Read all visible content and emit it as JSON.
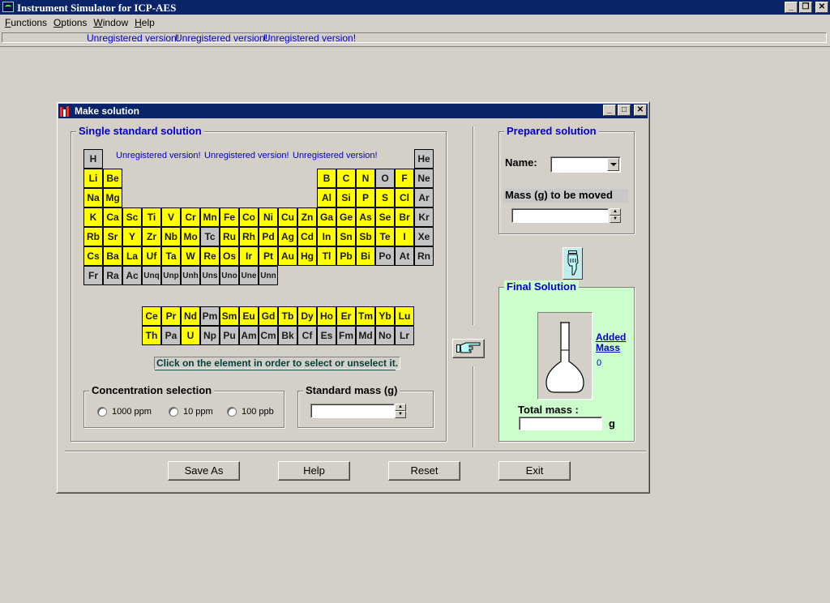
{
  "window": {
    "title": "Instrument Simulator for ICP-AES",
    "minimize": "_",
    "restore": "❐",
    "close": "✕"
  },
  "menu": {
    "items": [
      "Functions",
      "Options",
      "Window",
      "Help"
    ],
    "underlined": [
      "F",
      "O",
      "W",
      "H"
    ]
  },
  "status": {
    "unregistered": [
      "Unregistered version!",
      "Unregistered version!",
      "Unregistered version!"
    ]
  },
  "dialog": {
    "title": "Make solution",
    "single_standard": {
      "title": "Single standard solution",
      "unregistered": [
        "Unregistered version!",
        "Unregistered version!",
        "Unregistered version!"
      ],
      "elements": [
        {
          "s": "H",
          "c": "g"
        },
        {
          "s": "He",
          "c": "g"
        },
        {
          "s": "Li",
          "c": "y"
        },
        {
          "s": "Be",
          "c": "y"
        },
        {
          "s": "B",
          "c": "y"
        },
        {
          "s": "C",
          "c": "y"
        },
        {
          "s": "N",
          "c": "y"
        },
        {
          "s": "O",
          "c": "g"
        },
        {
          "s": "F",
          "c": "y"
        },
        {
          "s": "Ne",
          "c": "g"
        },
        {
          "s": "Na",
          "c": "y"
        },
        {
          "s": "Mg",
          "c": "y"
        },
        {
          "s": "Al",
          "c": "y"
        },
        {
          "s": "Si",
          "c": "y"
        },
        {
          "s": "P",
          "c": "y"
        },
        {
          "s": "S",
          "c": "y"
        },
        {
          "s": "Cl",
          "c": "y"
        },
        {
          "s": "Ar",
          "c": "g"
        },
        {
          "s": "K",
          "c": "y"
        },
        {
          "s": "Ca",
          "c": "y"
        },
        {
          "s": "Sc",
          "c": "y"
        },
        {
          "s": "Ti",
          "c": "y"
        },
        {
          "s": "V",
          "c": "y"
        },
        {
          "s": "Cr",
          "c": "y"
        },
        {
          "s": "Mn",
          "c": "y"
        },
        {
          "s": "Fe",
          "c": "y"
        },
        {
          "s": "Co",
          "c": "y"
        },
        {
          "s": "Ni",
          "c": "y"
        },
        {
          "s": "Cu",
          "c": "y"
        },
        {
          "s": "Zn",
          "c": "y"
        },
        {
          "s": "Ga",
          "c": "y"
        },
        {
          "s": "Ge",
          "c": "y"
        },
        {
          "s": "As",
          "c": "y"
        },
        {
          "s": "Se",
          "c": "y"
        },
        {
          "s": "Br",
          "c": "y"
        },
        {
          "s": "Kr",
          "c": "g"
        },
        {
          "s": "Rb",
          "c": "y"
        },
        {
          "s": "Sr",
          "c": "y"
        },
        {
          "s": "Y",
          "c": "y"
        },
        {
          "s": "Zr",
          "c": "y"
        },
        {
          "s": "Nb",
          "c": "y"
        },
        {
          "s": "Mo",
          "c": "y"
        },
        {
          "s": "Tc",
          "c": "g"
        },
        {
          "s": "Ru",
          "c": "y"
        },
        {
          "s": "Rh",
          "c": "y"
        },
        {
          "s": "Pd",
          "c": "y"
        },
        {
          "s": "Ag",
          "c": "y"
        },
        {
          "s": "Cd",
          "c": "y"
        },
        {
          "s": "In",
          "c": "y"
        },
        {
          "s": "Sn",
          "c": "y"
        },
        {
          "s": "Sb",
          "c": "y"
        },
        {
          "s": "Te",
          "c": "y"
        },
        {
          "s": "I",
          "c": "y"
        },
        {
          "s": "Xe",
          "c": "g"
        },
        {
          "s": "Cs",
          "c": "y"
        },
        {
          "s": "Ba",
          "c": "y"
        },
        {
          "s": "La",
          "c": "y"
        },
        {
          "s": "Uf",
          "c": "y"
        },
        {
          "s": "Ta",
          "c": "y"
        },
        {
          "s": "W",
          "c": "y"
        },
        {
          "s": "Re",
          "c": "y"
        },
        {
          "s": "Os",
          "c": "y"
        },
        {
          "s": "Ir",
          "c": "y"
        },
        {
          "s": "Pt",
          "c": "y"
        },
        {
          "s": "Au",
          "c": "y"
        },
        {
          "s": "Hg",
          "c": "y"
        },
        {
          "s": "Tl",
          "c": "y"
        },
        {
          "s": "Pb",
          "c": "y"
        },
        {
          "s": "Bi",
          "c": "y"
        },
        {
          "s": "Po",
          "c": "g"
        },
        {
          "s": "At",
          "c": "g"
        },
        {
          "s": "Rn",
          "c": "g"
        },
        {
          "s": "Fr",
          "c": "g"
        },
        {
          "s": "Ra",
          "c": "g"
        },
        {
          "s": "Ac",
          "c": "g"
        },
        {
          "s": "Unq",
          "c": "g"
        },
        {
          "s": "Unp",
          "c": "g"
        },
        {
          "s": "Unh",
          "c": "g"
        },
        {
          "s": "Uns",
          "c": "g"
        },
        {
          "s": "Uno",
          "c": "g"
        },
        {
          "s": "Une",
          "c": "g"
        },
        {
          "s": "Unn",
          "c": "g"
        },
        {
          "s": "Ce",
          "c": "y"
        },
        {
          "s": "Pr",
          "c": "y"
        },
        {
          "s": "Nd",
          "c": "y"
        },
        {
          "s": "Pm",
          "c": "g"
        },
        {
          "s": "Sm",
          "c": "y"
        },
        {
          "s": "Eu",
          "c": "y"
        },
        {
          "s": "Gd",
          "c": "y"
        },
        {
          "s": "Tb",
          "c": "y"
        },
        {
          "s": "Dy",
          "c": "y"
        },
        {
          "s": "Ho",
          "c": "y"
        },
        {
          "s": "Er",
          "c": "y"
        },
        {
          "s": "Tm",
          "c": "y"
        },
        {
          "s": "Yb",
          "c": "y"
        },
        {
          "s": "Lu",
          "c": "y"
        },
        {
          "s": "Th",
          "c": "y"
        },
        {
          "s": "Pa",
          "c": "g"
        },
        {
          "s": "U",
          "c": "y"
        },
        {
          "s": "Np",
          "c": "g"
        },
        {
          "s": "Pu",
          "c": "g"
        },
        {
          "s": "Am",
          "c": "g"
        },
        {
          "s": "Cm",
          "c": "g"
        },
        {
          "s": "Bk",
          "c": "g"
        },
        {
          "s": "Cf",
          "c": "g"
        },
        {
          "s": "Es",
          "c": "g"
        },
        {
          "s": "Fm",
          "c": "g"
        },
        {
          "s": "Md",
          "c": "g"
        },
        {
          "s": "No",
          "c": "g"
        },
        {
          "s": "Lr",
          "c": "g"
        }
      ],
      "hint": "Click on the element in order to select or unselect it."
    },
    "concentration": {
      "title": "Concentration selection",
      "options": [
        "1000 ppm",
        "10 ppm",
        "100 ppb"
      ]
    },
    "standard_mass": {
      "title": "Standard mass (g)",
      "value": ""
    },
    "prepared": {
      "title": "Prepared solution",
      "name_label": "Name:",
      "name_value": "",
      "mass_label": "Mass (g) to be moved",
      "mass_value": ""
    },
    "final": {
      "title": "Final Solution",
      "added_mass_label": "Added Mass",
      "added_mass_value": "0",
      "total_label": "Total mass :",
      "total_value": "",
      "unit": "g"
    },
    "buttons": {
      "save_as": "Save As",
      "help": "Help",
      "reset": "Reset",
      "exit": "Exit"
    }
  },
  "colors": {
    "titlebar": "#0a246a",
    "element_selectable": "#ffff00",
    "element_unavailable": "#c4c4c4",
    "final_panel": "#ccffcc",
    "link": "#0000c8"
  }
}
